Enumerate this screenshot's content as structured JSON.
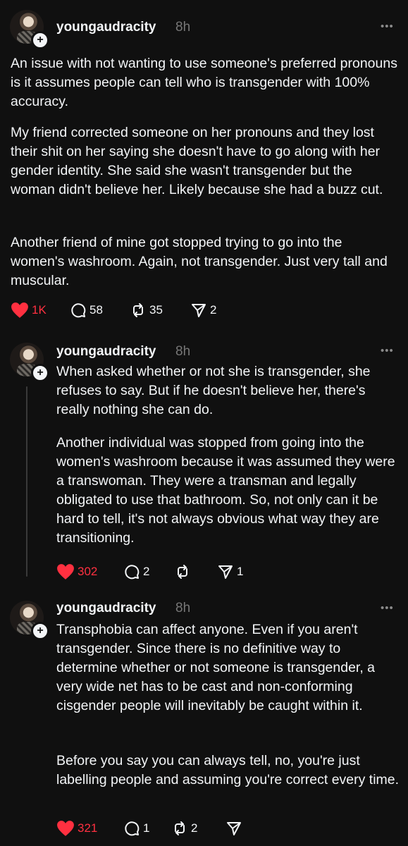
{
  "posts": [
    {
      "username": "youngaudracity",
      "time": "8h",
      "paragraphs": [
        "An issue with not wanting to use someone's preferred pronouns is it assumes people can tell who is transgender with 100% accuracy.",
        "My friend corrected someone on her pronouns and they lost their shit on her saying she doesn't have to go along with her gender identity. She said she wasn't transgender but the woman didn't believe her. Likely because she had a buzz cut.",
        "Another friend of mine got stopped trying to go into the women's washroom. Again, not transgender. Just very tall and muscular."
      ],
      "likes": "1K",
      "replies": "58",
      "reposts": "35",
      "shares": "2"
    },
    {
      "username": "youngaudracity",
      "time": "8h",
      "paragraphs": [
        "When asked whether or not she is transgender, she refuses to say. But if he doesn't believe her, there's really nothing she can do.",
        "Another individual was stopped from going into the women's washroom because it was assumed they were a transwoman. They were a transman and legally obligated to use that bathroom. So, not only can it be hard to tell, it's not always obvious what way they are transitioning."
      ],
      "likes": "302",
      "replies": "2",
      "reposts": "",
      "shares": "1"
    },
    {
      "username": "youngaudracity",
      "time": "8h",
      "paragraphs": [
        "Transphobia can affect anyone. Even if you aren't transgender. Since there is no definitive way to determine whether or not someone is transgender, a very wide net has to be cast and non-conforming cisgender people will inevitably be caught within it.",
        "Before you say you can always tell, no, you're just labelling people and assuming you're correct every time."
      ],
      "likes": "321",
      "replies": "1",
      "reposts": "2",
      "shares": ""
    }
  ],
  "colors": {
    "background": "#101010",
    "text": "#f3f5f7",
    "muted": "#777777",
    "like": "#ff3040"
  },
  "icons": {
    "like": "heart-icon",
    "reply": "comment-icon",
    "repost": "repost-icon",
    "share": "send-icon",
    "more": "more-icon",
    "follow": "plus-icon"
  }
}
